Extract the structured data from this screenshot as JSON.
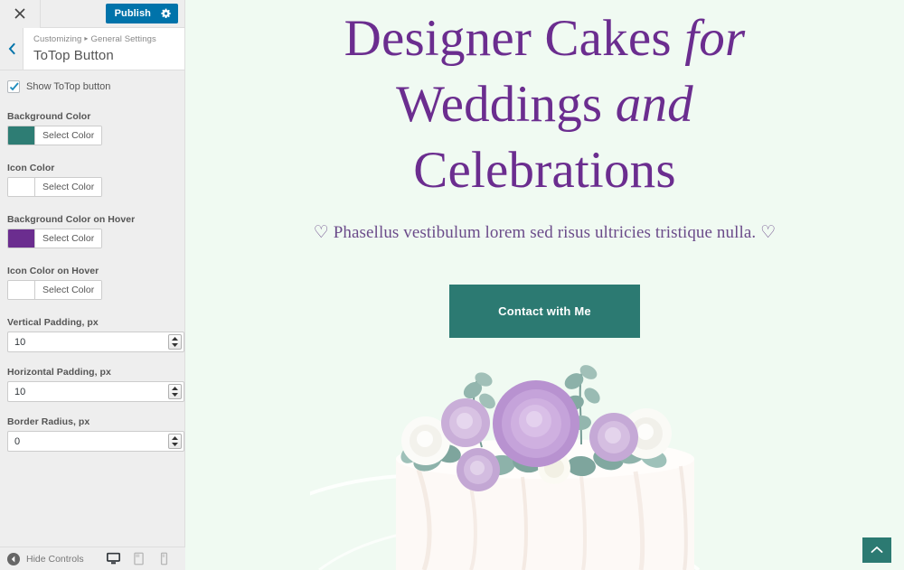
{
  "customizer": {
    "close_label": "Close customizer",
    "publish_label": "Publish",
    "gear_icon": "gear-icon",
    "back_label": "Back",
    "breadcrumb": {
      "root": "Customizing",
      "separator": "▸",
      "section": "General Settings"
    },
    "panel_title": "ToTop Button",
    "controls": {
      "show_button": {
        "label": "Show ToTop button",
        "checked": true
      },
      "colors": [
        {
          "label": "Background Color",
          "button_label": "Select Color",
          "value": "#2e7d74"
        },
        {
          "label": "Icon Color",
          "button_label": "Select Color",
          "value": "#ffffff"
        },
        {
          "label": "Background Color on Hover",
          "button_label": "Select Color",
          "value": "#6b2d8f"
        },
        {
          "label": "Icon Color on Hover",
          "button_label": "Select Color",
          "value": "#ffffff"
        }
      ],
      "numbers": [
        {
          "label": "Vertical Padding, px",
          "value": "10"
        },
        {
          "label": "Horizontal Padding, px",
          "value": "10"
        },
        {
          "label": "Border Radius, px",
          "value": "0"
        }
      ]
    },
    "footer": {
      "hide_controls_label": "Hide Controls",
      "devices": [
        {
          "name": "desktop",
          "active": true
        },
        {
          "name": "tablet",
          "active": false
        },
        {
          "name": "mobile",
          "active": false
        }
      ]
    }
  },
  "preview": {
    "background_color": "#f0faf2",
    "heading": {
      "line1_a": "Designer Cakes ",
      "line1_b": "for",
      "line2_a": "Weddings ",
      "line2_b": "and",
      "line3": "Celebrations",
      "color": "#6b2d8f"
    },
    "subtitle": "♡ Phasellus vestibulum lorem sed risus ultricies tristique nulla. ♡",
    "cta": {
      "label": "Contact with Me",
      "color": "#2c7a72"
    },
    "image_alt": "white wedding cake topped with purple and white roses and eucalyptus",
    "totop": {
      "icon": "chevron-up-icon",
      "background": "#2c7a72",
      "icon_color": "#ffffff"
    },
    "annotation": {
      "type": "red-arrow",
      "color": "#e8171b",
      "points_to": "totop-button"
    }
  }
}
